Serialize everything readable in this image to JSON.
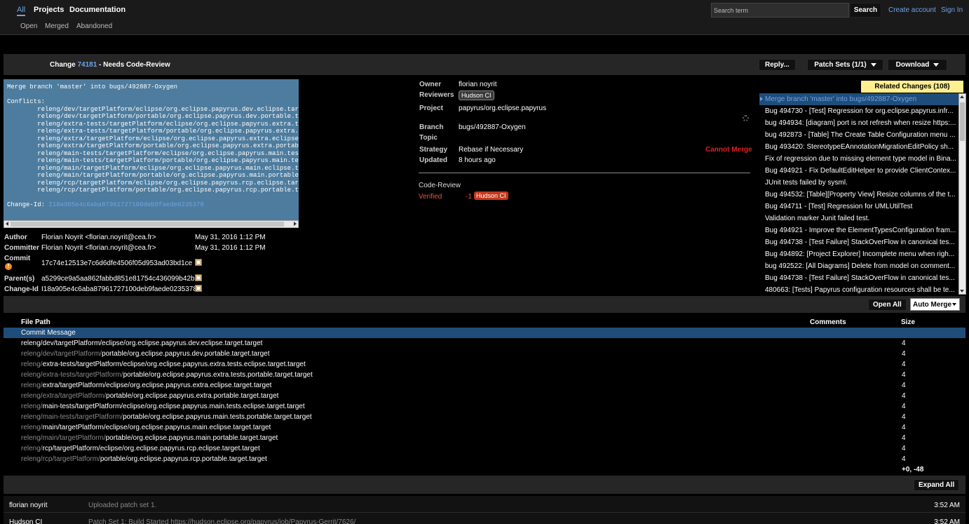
{
  "nav": {
    "menu": [
      "All",
      "Projects",
      "Documentation"
    ],
    "submenu": [
      "Open",
      "Merged",
      "Abandoned"
    ],
    "search_placeholder": "Search term",
    "search_button": "Search",
    "create_account": "Create account",
    "sign_in": "Sign In"
  },
  "change": {
    "prefix": "Change",
    "number": "74181",
    "status": "- Needs Code-Review",
    "buttons": {
      "reply": "Reply...",
      "patch_sets": "Patch Sets (1/1)",
      "download": "Download"
    }
  },
  "commit_message": "Merge branch 'master' into bugs/492887-Oxygen\n\nConflicts:\n        releng/dev/targetPlatform/eclipse/org.eclipse.papyrus.dev.eclipse.target.target\n        releng/dev/targetPlatform/portable/org.eclipse.papyrus.dev.portable.target.target\n        releng/extra-tests/targetPlatform/eclipse/org.eclipse.papyrus.extra.tests.eclipse.target.target\n        releng/extra-tests/targetPlatform/portable/org.eclipse.papyrus.extra.tests.portable.target.target\n        releng/extra/targetPlatform/eclipse/org.eclipse.papyrus.extra.eclipse.target.target\n        releng/extra/targetPlatform/portable/org.eclipse.papyrus.extra.portable.target.target\n        releng/main-tests/targetPlatform/eclipse/org.eclipse.papyrus.main.tests.eclipse.target.target\n        releng/main-tests/targetPlatform/portable/org.eclipse.papyrus.main.tests.portable.target.target\n        releng/main/targetPlatform/eclipse/org.eclipse.papyrus.main.eclipse.target.target\n        releng/main/targetPlatform/portable/org.eclipse.papyrus.main.portable.target.target\n        releng/rcp/targetPlatform/eclipse/org.eclipse.papyrus.rcp.eclipse.target.target\n        releng/rcp/targetPlatform/portable/org.eclipse.papyrus.rcp.portable.target.target\n\n",
  "change_id_label": "Change-Id:",
  "change_id_value": "I18a905e4c6aba87961727100deb9faede0235378",
  "info": {
    "author_label": "Author",
    "author": "Florian Noyrit <florian.noyrit@cea.fr>",
    "author_date": "May 31, 2016 1:12 PM",
    "committer_label": "Committer",
    "committer": "Florian Noyrit <florian.noyrit@cea.fr>",
    "committer_date": "May 31, 2016 1:12 PM",
    "commit_label": "Commit",
    "commit": "17c74e12513e7c6d6dfe4506f05d953ad03bd1ce",
    "parents_label": "Parent(s)",
    "parents": "a5299ce9a5aa862fabbd851e81754c436099b42b",
    "changeid_label": "Change-Id",
    "changeid": "I18a905e4c6aba87961727100deb9faede0235378"
  },
  "meta": {
    "owner_label": "Owner",
    "owner": "florian noyrit",
    "reviewers_label": "Reviewers",
    "reviewer": "Hudson CI",
    "project_label": "Project",
    "project": "papyrus/org.eclipse.papyrus",
    "branch_label": "Branch",
    "branch": "bugs/492887-Oxygen",
    "topic_label": "Topic",
    "strategy_label": "Strategy",
    "strategy": "Rebase if Necessary",
    "cannot_merge": "Cannot Merge",
    "updated_label": "Updated",
    "updated": "8 hours ago",
    "code_review": "Code-Review",
    "verified_label": "Verified",
    "verified_score": "-1",
    "verified_by": "Hudson CI"
  },
  "related": {
    "tab": "Related Changes (108)",
    "items": [
      "Merge branch 'master' into bugs/492887-Oxygen",
      "Bug 494730 - [Test] Regression for org.eclipse.papyrus.infr...",
      "bug 494934: [diagram] port is not refresh when resize https:...",
      "bug 492873 - [Table] The Create Table Configuration menu ...",
      "Bug 493420: StereotypeEAnnotationMigrationEditPolicy sh...",
      "Fix of regression due to missing element type model in Bina...",
      "Bug 494921 - Fix DefaultEditHelper to provide ClientContex...",
      "JUnit tests failed by sysml.",
      "Bug 494532: [Table][Property View] Resize columns of the t...",
      "Bug 494711 - [Test] Regression for UMLUtilTest",
      "Validation marker Junit failed test.",
      "Bug 494921 - Improve the ElementTypesConfiguration fram...",
      "Bug 494738 - [Test Failure] StackOverFlow in canonical tes...",
      "Bug 494892: [Project Explorer] Incomplete menu when righ...",
      "bug 492522: [All Diagrams] Delete from model on comment...",
      "Bug 494738 - [Test Failure] StackOverFlow in canonical tes...",
      "480663: [Tests] Papyrus configuration resources shall be te..."
    ]
  },
  "files": {
    "open_all": "Open All",
    "auto_merge": "Auto Merge",
    "col_path": "File Path",
    "col_comments": "Comments",
    "col_size": "Size",
    "commit_msg_row": "Commit Message",
    "rows": [
      {
        "dim": "",
        "rest": "releng/dev/targetPlatform/eclipse/org.eclipse.papyrus.dev.eclipse.target.target",
        "size": "4"
      },
      {
        "dim": "releng/dev/targetPlatform/",
        "rest": "portable/org.eclipse.papyrus.dev.portable.target.target",
        "size": "4"
      },
      {
        "dim": "releng/",
        "rest": "extra-tests/targetPlatform/eclipse/org.eclipse.papyrus.extra.tests.eclipse.target.target",
        "size": "4"
      },
      {
        "dim": "releng/extra-tests/targetPlatform/",
        "rest": "portable/org.eclipse.papyrus.extra.tests.portable.target.target",
        "size": "4"
      },
      {
        "dim": "releng/",
        "rest": "extra/targetPlatform/eclipse/org.eclipse.papyrus.extra.eclipse.target.target",
        "size": "4"
      },
      {
        "dim": "releng/extra/targetPlatform/",
        "rest": "portable/org.eclipse.papyrus.extra.portable.target.target",
        "size": "4"
      },
      {
        "dim": "releng/",
        "rest": "main-tests/targetPlatform/eclipse/org.eclipse.papyrus.main.tests.eclipse.target.target",
        "size": "4"
      },
      {
        "dim": "releng/main-tests/targetPlatform/",
        "rest": "portable/org.eclipse.papyrus.main.tests.portable.target.target",
        "size": "4"
      },
      {
        "dim": "releng/",
        "rest": "main/targetPlatform/eclipse/org.eclipse.papyrus.main.eclipse.target.target",
        "size": "4"
      },
      {
        "dim": "releng/main/targetPlatform/",
        "rest": "portable/org.eclipse.papyrus.main.portable.target.target",
        "size": "4"
      },
      {
        "dim": "releng/",
        "rest": "rcp/targetPlatform/eclipse/org.eclipse.papyrus.rcp.eclipse.target.target",
        "size": "4"
      },
      {
        "dim": "releng/rcp/targetPlatform/",
        "rest": "portable/org.eclipse.papyrus.rcp.portable.target.target",
        "size": "4"
      }
    ],
    "totals": "+0, -48"
  },
  "history": {
    "expand_all": "Expand All",
    "rows": [
      {
        "who": "florian noyrit",
        "what": "Uploaded patch set 1.",
        "when": "3:52 AM"
      },
      {
        "who": "Hudson CI",
        "what": "Patch Set 1: Build Started https://hudson.eclipse.org/papyrus/job/Papyrus-Gerrit/7626/",
        "when": "3:52 AM"
      }
    ]
  }
}
